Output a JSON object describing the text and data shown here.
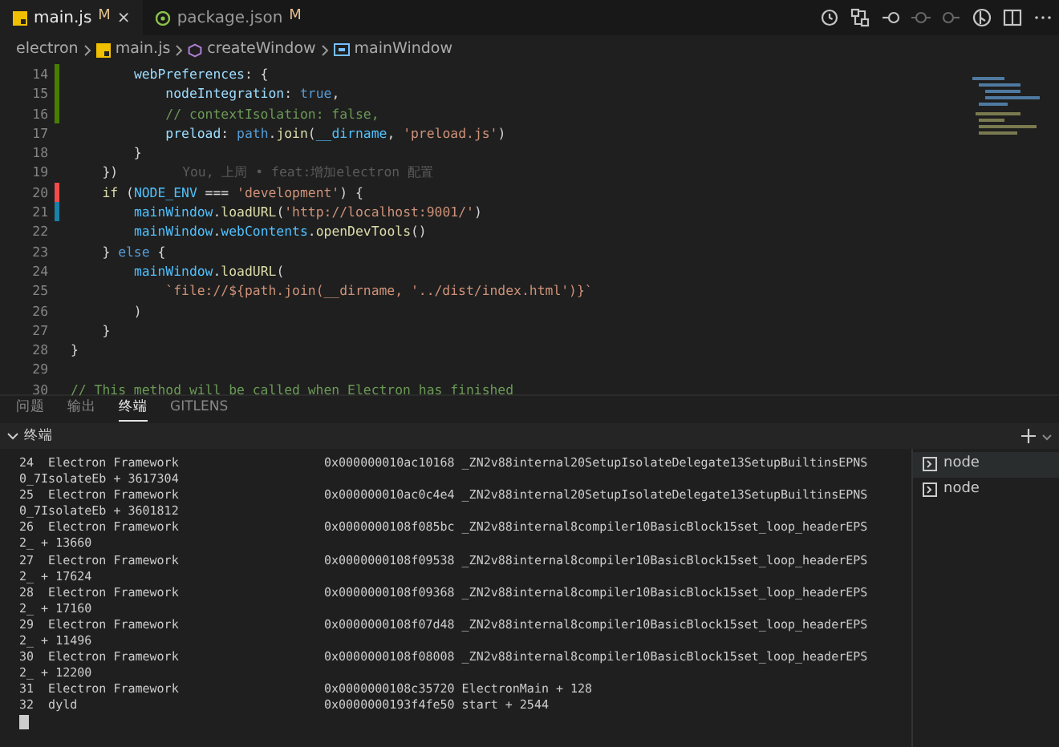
{
  "editor_tabs": [
    {
      "label": "main.js",
      "badge": "M",
      "close": "×",
      "kind": "js",
      "selected": true
    },
    {
      "label": "package.json",
      "badge": "M",
      "kind": "json",
      "selected": false
    }
  ],
  "breadcrumb": [
    {
      "label": "electron",
      "kind": "folder"
    },
    {
      "label": "main.js",
      "kind": "js"
    },
    {
      "label": "createWindow",
      "kind": "method"
    },
    {
      "label": "mainWindow",
      "kind": "variable"
    }
  ],
  "code_lines": [
    {
      "number": "14",
      "color": "#487e02",
      "code": "        webPreferences: {"
    },
    {
      "number": "15",
      "color": "#487e02",
      "code": "            nodeIntegration: true,"
    },
    {
      "number": "16",
      "color": "#487e02",
      "code": "            // contextIsolation: false,"
    },
    {
      "number": "17",
      "code": "            preload: path.join(__dirname, 'preload.js')"
    },
    {
      "number": "18",
      "code": "        }"
    },
    {
      "number": "19",
      "code": "    })",
      "blame": "You, 上周 • feat:增加electron 配置"
    },
    {
      "number": "20",
      "color": "#f14c4c",
      "code": "    if (NODE_ENV === 'development') {"
    },
    {
      "number": "21",
      "color": "#1b81a8",
      "code": "        mainWindow.loadURL('http://localhost:9001/')"
    },
    {
      "number": "22",
      "code": "        mainWindow.webContents.openDevTools()"
    },
    {
      "number": "23",
      "code": "    } else {"
    },
    {
      "number": "24",
      "code": "        mainWindow.loadURL("
    },
    {
      "number": "25",
      "code": "            `file://${path.join(__dirname, '../dist/index.html')}`"
    },
    {
      "number": "26",
      "code": "        )"
    },
    {
      "number": "27",
      "code": "    }"
    },
    {
      "number": "28",
      "code": "}"
    },
    {
      "number": "29"
    },
    {
      "number": "30",
      "code": "// This method will be called when Electron has finished"
    }
  ],
  "panel_tabs": [
    {
      "label": "问题",
      "selected": false
    },
    {
      "label": "输出",
      "selected": false
    },
    {
      "label": "终端",
      "selected": true
    },
    {
      "label": "GITLENS",
      "selected": false
    }
  ],
  "terminal_section": {
    "title": "终端",
    "expanded": true
  },
  "terminal_lines": [
    {
      "frame": "24  Electron Framework",
      "address": "0x000000010ac10168 _ZN2v88internal20SetupIsolateDelegate13SetupBuiltinsEPNS"
    },
    {
      "frame": "0_7IsolateEb + 3617304"
    },
    {
      "frame": "25  Electron Framework",
      "address": "0x000000010ac0c4e4 _ZN2v88internal20SetupIsolateDelegate13SetupBuiltinsEPNS"
    },
    {
      "frame": "0_7IsolateEb + 3601812"
    },
    {
      "frame": "26  Electron Framework",
      "address": "0x0000000108f085bc _ZN2v88internal8compiler10BasicBlock15set_loop_headerEPS"
    },
    {
      "frame": "2_ + 13660"
    },
    {
      "frame": "27  Electron Framework",
      "address": "0x0000000108f09538 _ZN2v88internal8compiler10BasicBlock15set_loop_headerEPS"
    },
    {
      "frame": "2_ + 17624"
    },
    {
      "frame": "28  Electron Framework",
      "address": "0x0000000108f09368 _ZN2v88internal8compiler10BasicBlock15set_loop_headerEPS"
    },
    {
      "frame": "2_ + 17160"
    },
    {
      "frame": "29  Electron Framework",
      "address": "0x0000000108f07d48 _ZN2v88internal8compiler10BasicBlock15set_loop_headerEPS"
    },
    {
      "frame": "2_ + 11496"
    },
    {
      "frame": "30  Electron Framework",
      "address": "0x0000000108f08008 _ZN2v88internal8compiler10BasicBlock15set_loop_headerEPS"
    },
    {
      "frame": "2_ + 12200"
    },
    {
      "frame": "31  Electron Framework",
      "address": "0x0000000108c35720 ElectronMain + 128"
    },
    {
      "frame": "32  dyld",
      "address": "0x0000000193f4fe50 start + 2544"
    }
  ],
  "terminals": [
    {
      "label": "node",
      "selected": true
    },
    {
      "label": "node",
      "selected": false
    }
  ]
}
